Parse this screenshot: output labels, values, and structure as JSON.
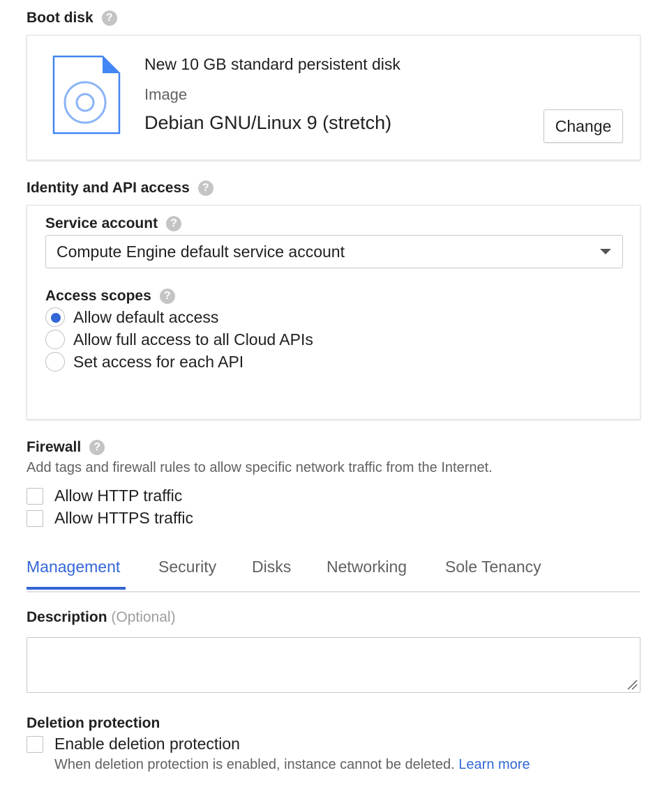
{
  "boot_disk": {
    "title": "Boot disk",
    "help": "?",
    "disk_name": "New 10 GB standard persistent disk",
    "image_label": "Image",
    "image_name": "Debian GNU/Linux 9 (stretch)",
    "change_label": "Change"
  },
  "identity": {
    "title": "Identity and API access",
    "help": "?",
    "service_account_label": "Service account",
    "service_account_value": "Compute Engine default service account",
    "access_scopes_label": "Access scopes",
    "scopes": [
      {
        "label": "Allow default access",
        "checked": true
      },
      {
        "label": "Allow full access to all Cloud APIs",
        "checked": false
      },
      {
        "label": "Set access for each API",
        "checked": false
      }
    ]
  },
  "firewall": {
    "title": "Firewall",
    "help": "?",
    "description": "Add tags and firewall rules to allow specific network traffic from the Internet.",
    "options": [
      {
        "label": "Allow HTTP traffic",
        "checked": false
      },
      {
        "label": "Allow HTTPS traffic",
        "checked": false
      }
    ]
  },
  "tabs": [
    {
      "label": "Management",
      "active": true
    },
    {
      "label": "Security",
      "active": false
    },
    {
      "label": "Disks",
      "active": false
    },
    {
      "label": "Networking",
      "active": false
    },
    {
      "label": "Sole Tenancy",
      "active": false
    }
  ],
  "description": {
    "label": "Description",
    "optional": "(Optional)",
    "value": ""
  },
  "deletion": {
    "title": "Deletion protection",
    "checkbox_label": "Enable deletion protection",
    "hint": "When deletion protection is enabled, instance cannot be deleted.",
    "learn_more": "Learn more"
  },
  "colors": {
    "accent": "#3367d6",
    "icon_blue": "#4285f4"
  }
}
